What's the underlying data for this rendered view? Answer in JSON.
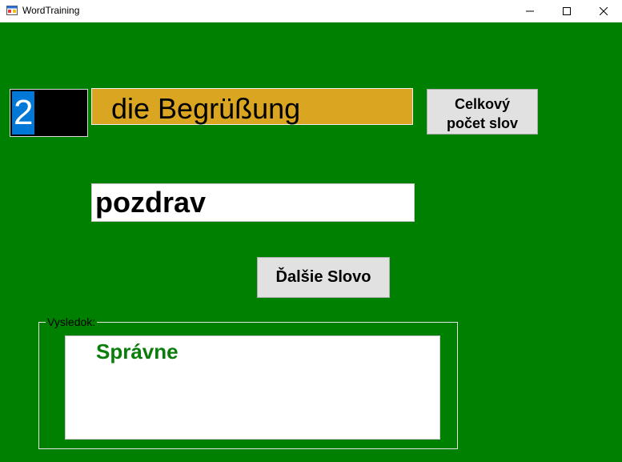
{
  "window": {
    "title": "WordTraining"
  },
  "counter": {
    "value": "2"
  },
  "word": {
    "text": "die Begrüßung"
  },
  "total_button": {
    "label_line1": "Celkový",
    "label_line2": "počet slov"
  },
  "answer": {
    "value": "pozdrav"
  },
  "next_button": {
    "label": "Ďalšie Slovo"
  },
  "result": {
    "legend": "Vysledok:",
    "text": "Správne",
    "text_color": "#0a7d0a"
  },
  "colors": {
    "background": "#008000",
    "word_box": "#daa520",
    "counter_bg": "#000000",
    "selection": "#0078d7"
  },
  "icons": [
    "app-icon",
    "minimize-icon",
    "maximize-icon",
    "close-icon"
  ]
}
